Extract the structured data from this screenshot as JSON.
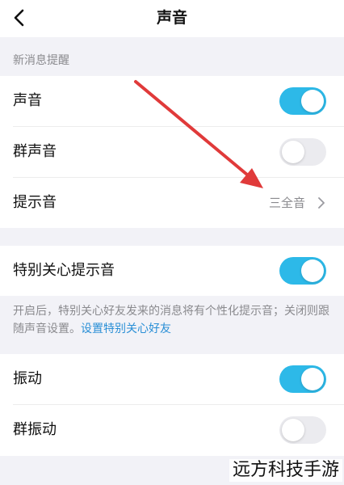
{
  "nav": {
    "title": "声音"
  },
  "section_header": "新消息提醒",
  "rows": {
    "sound": {
      "label": "声音",
      "toggle_on": true
    },
    "group_sound": {
      "label": "群声音",
      "toggle_on": false
    },
    "alert_tone": {
      "label": "提示音",
      "value": "三全音"
    },
    "special_care_tone": {
      "label": "特别关心提示音",
      "toggle_on": true
    },
    "vibrate": {
      "label": "振动",
      "toggle_on": true
    },
    "group_vibrate": {
      "label": "群振动",
      "toggle_on": false
    }
  },
  "description": {
    "text": "开启后，特别关心好友发来的消息将有个性化提示音；关闭则跟随声音设置。",
    "link": "设置特别关心好友"
  },
  "watermark": "远方科技手游",
  "colors": {
    "toggle_on": "#2db9e8",
    "toggle_off": "#ebebef",
    "annotation_arrow": "#e03a3a",
    "link": "#2a8fd6"
  }
}
